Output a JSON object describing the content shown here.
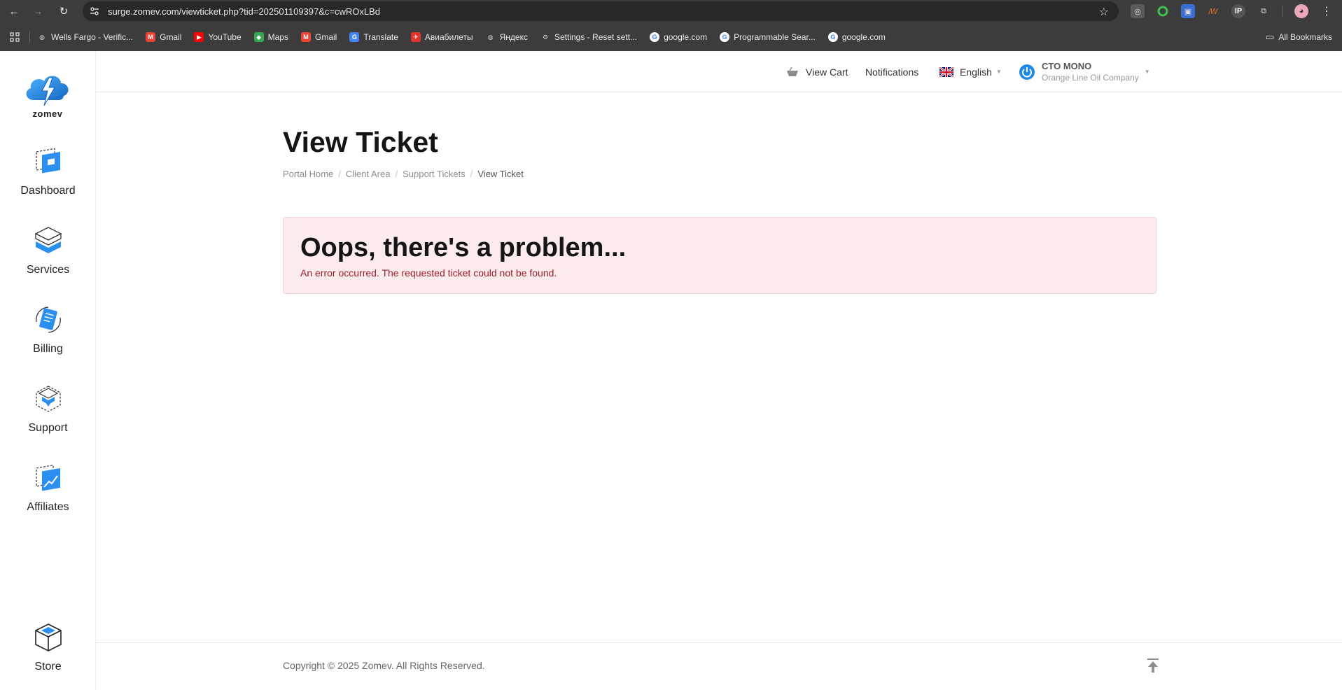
{
  "browser": {
    "url": "surge.zomev.com/viewticket.php?tid=202501109397&c=cwROxLBd",
    "bookmarks": [
      {
        "label": "Wells Fargo - Verific...",
        "icon": "globe-icon",
        "color": "#9aa0a6"
      },
      {
        "label": "Gmail",
        "icon": "gmail-icon",
        "color": "#ea4335"
      },
      {
        "label": "YouTube",
        "icon": "youtube-icon",
        "color": "#ff0000"
      },
      {
        "label": "Maps",
        "icon": "maps-icon",
        "color": "#34a853"
      },
      {
        "label": "Gmail",
        "icon": "gmail-icon",
        "color": "#ea4335"
      },
      {
        "label": "Translate",
        "icon": "translate-icon",
        "color": "#4285f4"
      },
      {
        "label": "Авиабилеты",
        "icon": "tickets-icon",
        "color": "#e5322d"
      },
      {
        "label": "Яндекс",
        "icon": "globe-icon",
        "color": "#9aa0a6"
      },
      {
        "label": "Settings - Reset sett...",
        "icon": "gear-icon",
        "color": "#9aa0a6"
      },
      {
        "label": "google.com",
        "icon": "google-icon",
        "color": "#4285f4"
      },
      {
        "label": "Programmable Sear...",
        "icon": "google-icon",
        "color": "#4285f4"
      },
      {
        "label": "google.com",
        "icon": "google-icon",
        "color": "#4285f4"
      }
    ],
    "all_bookmarks": "All Bookmarks"
  },
  "brand": {
    "logo_text": "zomev",
    "accent": "#1e88e5"
  },
  "sidebar": {
    "items": [
      {
        "label": "Dashboard",
        "icon": "dashboard-icon"
      },
      {
        "label": "Services",
        "icon": "services-icon"
      },
      {
        "label": "Billing",
        "icon": "billing-icon"
      },
      {
        "label": "Support",
        "icon": "support-icon"
      },
      {
        "label": "Affiliates",
        "icon": "affiliates-icon"
      },
      {
        "label": "Store",
        "icon": "store-icon"
      }
    ]
  },
  "header": {
    "view_cart": "View Cart",
    "notifications": "Notifications",
    "language": "English",
    "user_name": "CTO MONO",
    "company": "Orange Line Oil Company"
  },
  "main": {
    "title": "View Ticket",
    "breadcrumb": [
      "Portal Home",
      "Client Area",
      "Support Tickets",
      "View Ticket"
    ],
    "alert_title": "Oops, there's a problem...",
    "alert_text": "An error occurred. The requested ticket could not be found."
  },
  "footer": {
    "copyright": "Copyright © 2025 Zomev. All Rights Reserved."
  }
}
